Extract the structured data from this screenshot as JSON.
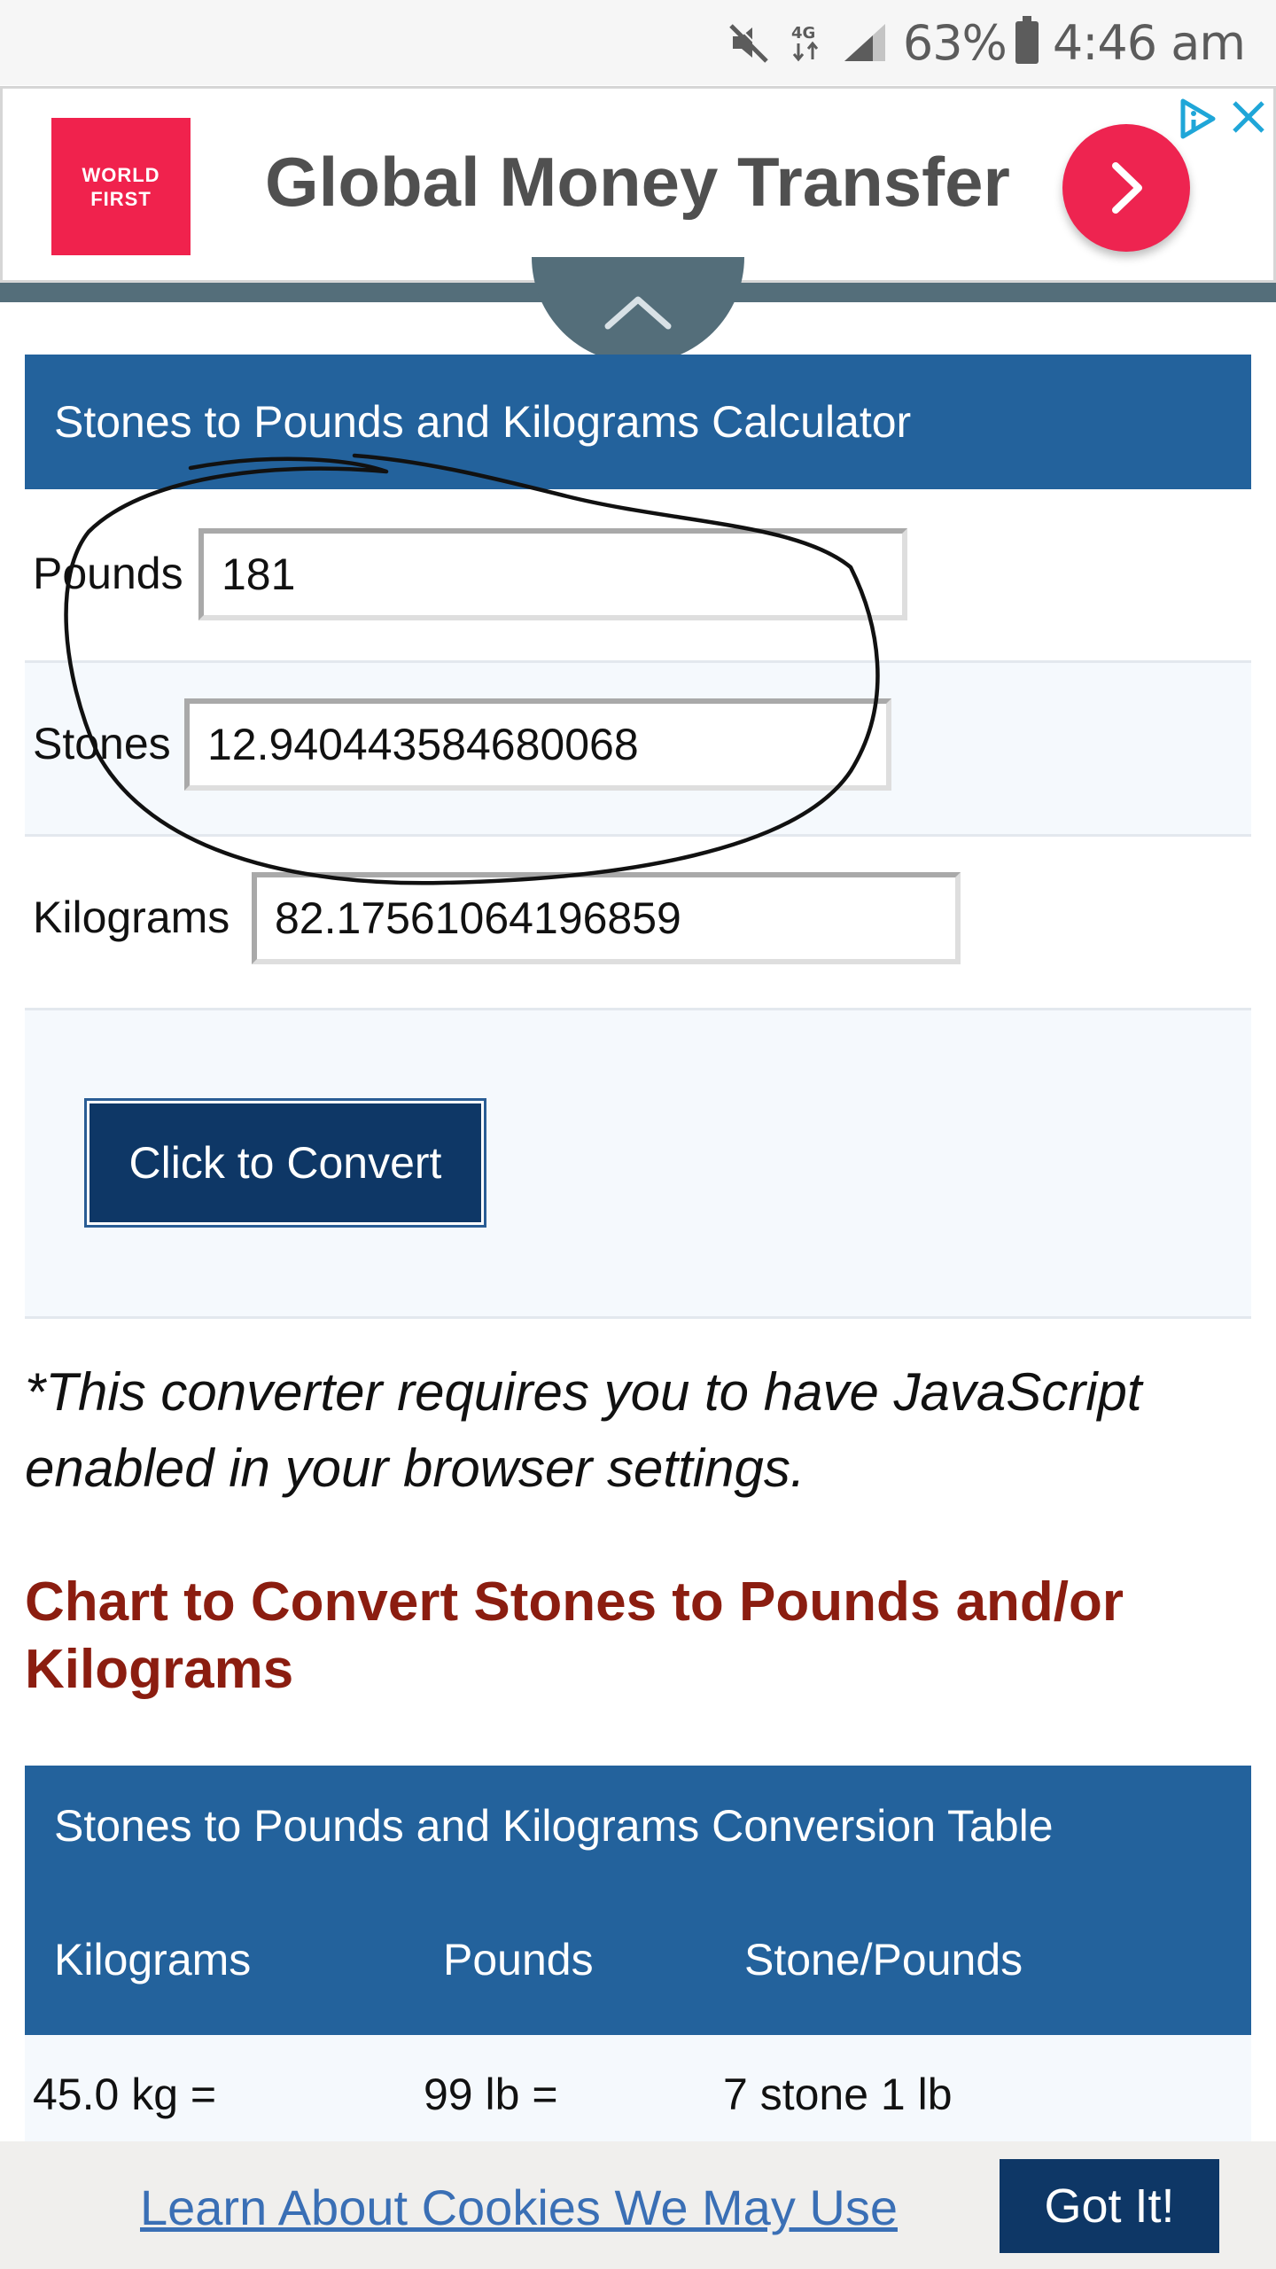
{
  "status_bar": {
    "network": "4G",
    "battery": "63%",
    "time": "4:46 am"
  },
  "ad": {
    "logo_text": "WORLD FIRST",
    "title": "Global Money Transfer",
    "cta_icon": "chevron-right-icon",
    "choices_icon": "adchoices-icon",
    "close_icon": "close-icon",
    "brand_color": "#f0224d"
  },
  "calculator": {
    "header": "Stones to Pounds and Kilograms Calculator",
    "pounds": {
      "label": "Pounds",
      "value": "181"
    },
    "stones": {
      "label": "Stones",
      "value": "12.940443584680068"
    },
    "kilograms": {
      "label": "Kilograms",
      "value": "82.17561064196859"
    },
    "convert_label": "Click to Convert",
    "header_color": "#23629c"
  },
  "note": "*This converter requires you to have JavaScript enabled in your browser settings.",
  "chart_heading": "Chart to Convert Stones to Pounds and/or Kilograms",
  "table": {
    "caption": "Stones to Pounds and Kilograms Conversion Table",
    "headers": [
      "Kilograms",
      "Pounds",
      "Stone/Pounds"
    ],
    "rows": [
      [
        "45.0 kg =",
        "99 lb =",
        "7 stone 1 lb"
      ]
    ]
  },
  "cookie_bar": {
    "link": "Learn About Cookies We May Use",
    "button": "Got It!"
  }
}
